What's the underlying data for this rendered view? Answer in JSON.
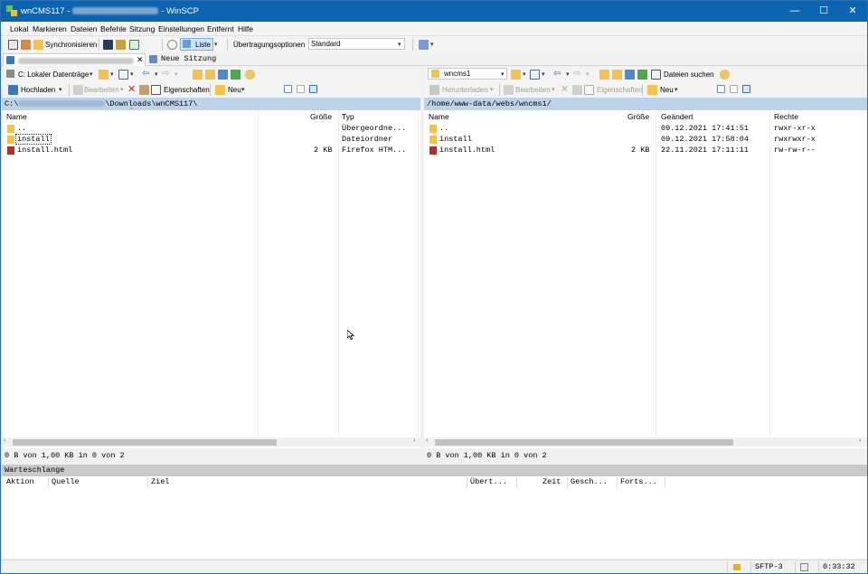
{
  "window": {
    "title_prefix": "wnCMS117 -",
    "title_suffix": "- WinSCP",
    "controls": {
      "minimize": "—",
      "maximize": "☐",
      "close": "✕"
    }
  },
  "menu": [
    "Lokal",
    "Markieren",
    "Dateien",
    "Befehle",
    "Sitzung",
    "Einstellungen",
    "Entfernt",
    "Hilfe"
  ],
  "toolbar": {
    "sync_label": "Synchronisieren",
    "view_label": "Liste",
    "transfer_options_label": "Übertragungsoptionen",
    "transfer_options_value": "Standard"
  },
  "tabs": {
    "new_session_label": "Neue Sitzung",
    "close_glyph": "✕"
  },
  "left": {
    "drive_label": "C: Lokaler Datenträge",
    "upload_label": "Hochladen",
    "edit_label": "Bearbeiten",
    "properties_label": "Eigenschaften",
    "new_label": "Neu",
    "path_prefix": "C:\\",
    "path_suffix": "\\Downloads\\wnCMS117\\",
    "columns": {
      "name": "Name",
      "size": "Größe",
      "type": "Typ"
    },
    "rows": [
      {
        "name": "..",
        "size": "",
        "type": "Übergeordne..."
      },
      {
        "name": "install",
        "size": "",
        "type": "Dateiordner"
      },
      {
        "name": "install.html",
        "size": "2 KB",
        "type": "Firefox HTM..."
      }
    ],
    "status": "0 B von 1,00 KB in 0 von 2"
  },
  "right": {
    "dir_label": "wncms1",
    "find_label": "Dateien suchen",
    "download_label": "Herunterladen",
    "edit_label": "Bearbeiten",
    "properties_label": "Eigenschaften",
    "new_label": "Neu",
    "path": "/home/www-data/webs/wncms1/",
    "columns": {
      "name": "Name",
      "size": "Größe",
      "changed": "Geändert",
      "rights": "Rechte"
    },
    "rows": [
      {
        "name": "..",
        "size": "",
        "changed": "09.12.2021 17:41:51",
        "rights": "rwxr-xr-x"
      },
      {
        "name": "install",
        "size": "",
        "changed": "09.12.2021 17:58:04",
        "rights": "rwxrwxr-x"
      },
      {
        "name": "install.html",
        "size": "2 KB",
        "changed": "22.11.2021 17:11:11",
        "rights": "rw-rw-r--"
      }
    ],
    "status": "0 B von 1,00 KB in 0 von 2"
  },
  "queue": {
    "title": "Warteschlange",
    "columns": {
      "action": "Aktion",
      "source": "Quelle",
      "target": "Ziel",
      "transferred": "Übert...",
      "time": "Zeit",
      "speed": "Gesch...",
      "progress": "Forts..."
    }
  },
  "statusbar": {
    "protocol": "SFTP-3",
    "elapsed": "0:33:32"
  },
  "colors": {
    "titlebar": "#0a64b0",
    "pathbar": "#bcd3ea",
    "folder": "#f2c14e"
  }
}
